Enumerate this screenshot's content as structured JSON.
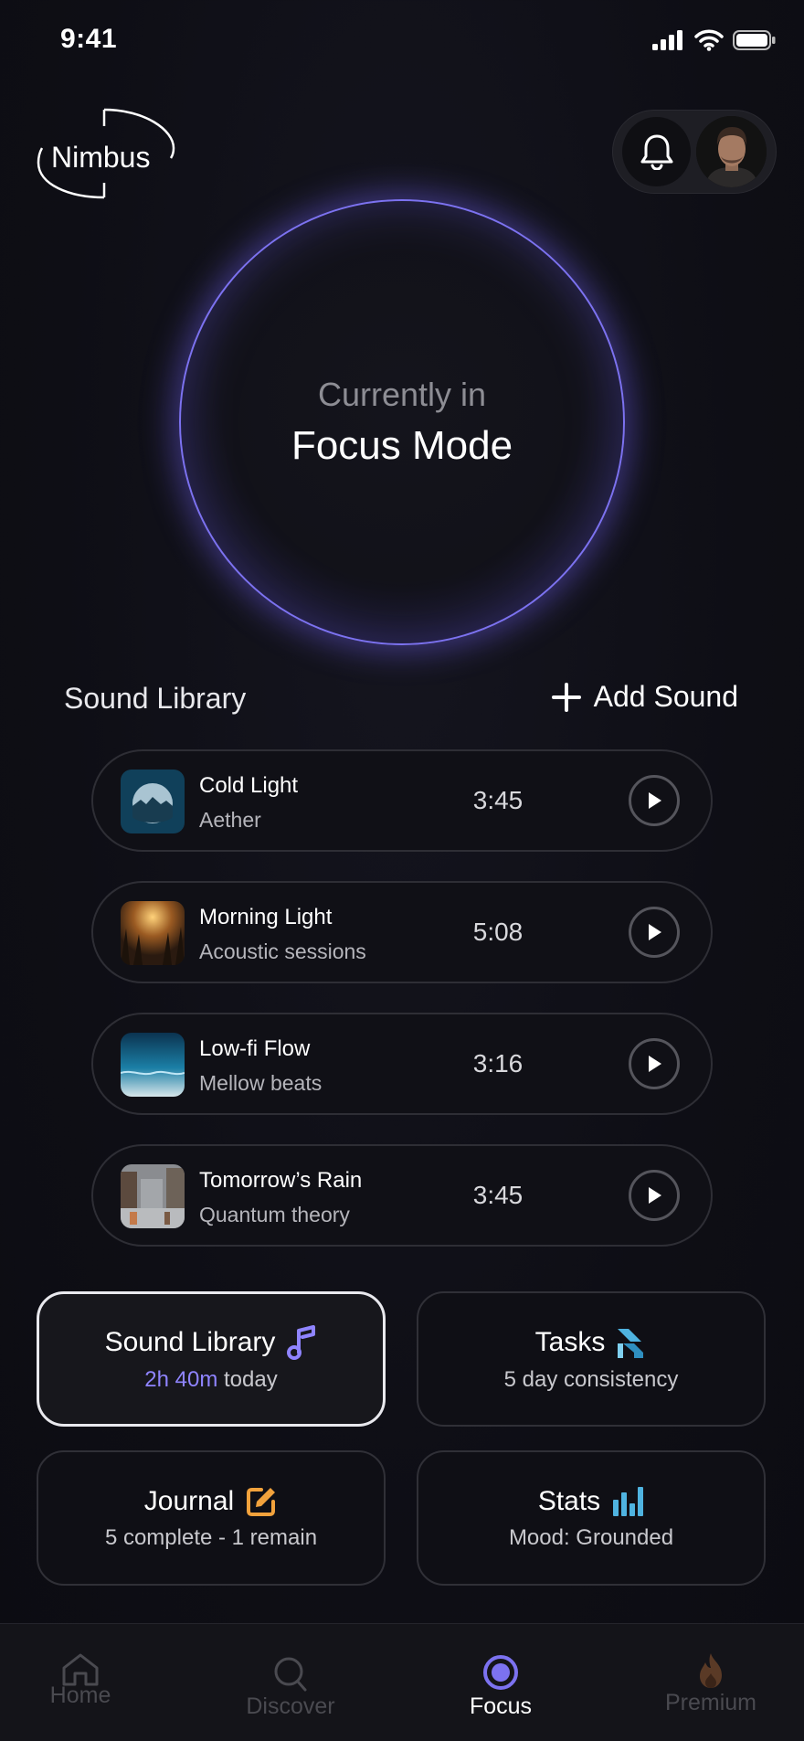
{
  "status_bar": {
    "time": "9:41"
  },
  "header": {
    "logo_text": "Nimbus"
  },
  "focus": {
    "subtitle": "Currently in",
    "title": "Focus Mode",
    "accent_color": "#7c72f0"
  },
  "library": {
    "title": "Sound Library",
    "add_label": "Add Sound",
    "tracks": [
      {
        "title": "Cold Light",
        "artist": "Aether",
        "duration": "3:45"
      },
      {
        "title": "Morning Light",
        "artist": "Acoustic sessions",
        "duration": "5:08"
      },
      {
        "title": "Low-fi Flow",
        "artist": "Mellow beats",
        "duration": "3:16"
      },
      {
        "title": "Tomorrow’s Rain",
        "artist": "Quantum theory",
        "duration": "3:45"
      }
    ]
  },
  "cards": {
    "sound": {
      "title": "Sound Library",
      "value": "2h 40m",
      "suffix": " today"
    },
    "tasks": {
      "title": "Tasks",
      "subtitle": "5 day consistency"
    },
    "journal": {
      "title": "Journal",
      "subtitle": "5 complete - 1 remain"
    },
    "stats": {
      "title": "Stats",
      "subtitle": "Mood: Grounded"
    }
  },
  "tabs": [
    {
      "label": "Home",
      "icon": "home-icon"
    },
    {
      "label": "Discover",
      "icon": "search-icon"
    },
    {
      "label": "Focus",
      "icon": "focus-icon",
      "active": true
    },
    {
      "label": "Premium",
      "icon": "flame-icon"
    }
  ],
  "colors": {
    "accent": "#8f84ff",
    "tasks": "#4fb3e0",
    "journal": "#f2a23c",
    "stats": "#4fb3e0"
  }
}
